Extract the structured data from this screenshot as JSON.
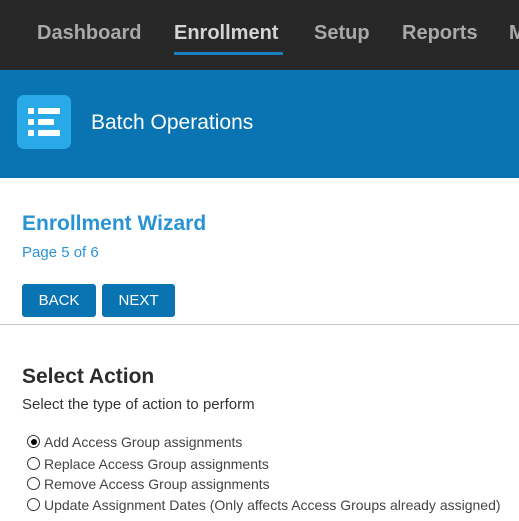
{
  "nav": {
    "items": [
      "Dashboard",
      "Enrollment",
      "Setup",
      "Reports",
      "M"
    ],
    "active": "Enrollment"
  },
  "banner": {
    "icon": "list-icon",
    "title": "Batch Operations"
  },
  "wizard": {
    "title": "Enrollment Wizard",
    "page": "Page 5 of 6",
    "back_label": "BACK",
    "next_label": "NEXT"
  },
  "section": {
    "title": "Select Action",
    "description": "Select the type of action to perform"
  },
  "options": [
    {
      "label": "Add Access Group assignments",
      "selected": true
    },
    {
      "label": "Replace Access Group assignments",
      "selected": false
    },
    {
      "label": "Remove Access Group assignments",
      "selected": false
    },
    {
      "label": "Update Assignment Dates (Only affects Access Groups already assigned)",
      "selected": false
    }
  ],
  "colors": {
    "nav_bg": "#282828",
    "banner_bg": "#0a74b3",
    "accent": "#2a93d5",
    "button_bg": "#0a74b3"
  }
}
